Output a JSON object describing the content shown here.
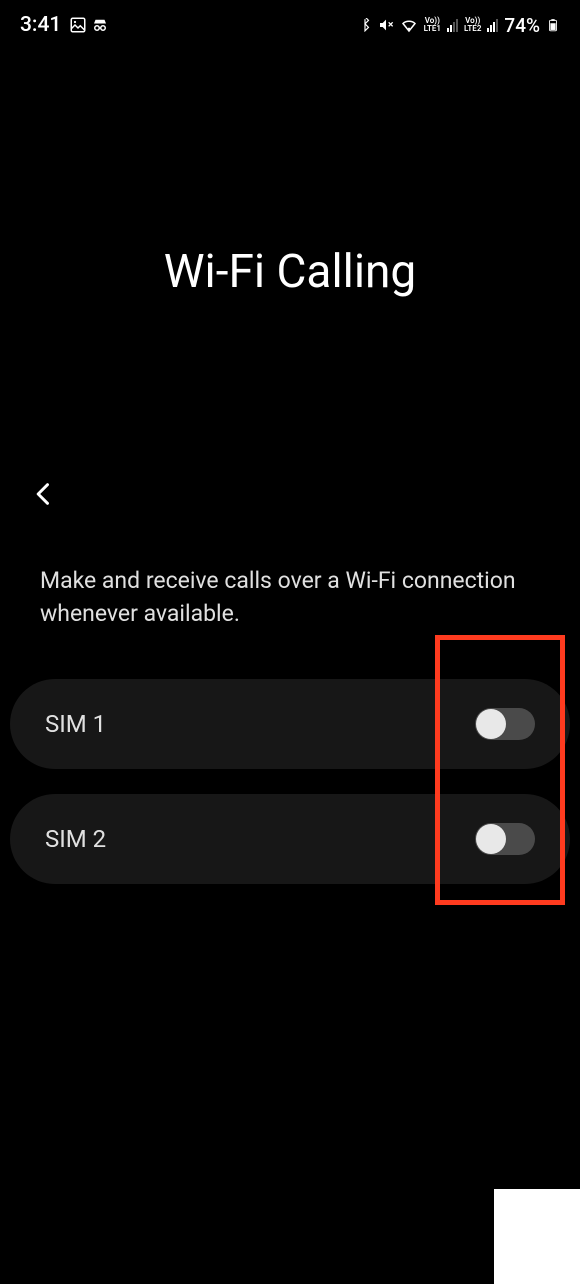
{
  "status": {
    "time": "3:41",
    "battery": "74%"
  },
  "page": {
    "title": "Wi-Fi Calling",
    "description": "Make and receive calls over a Wi-Fi connection whenever available."
  },
  "sims": [
    {
      "label": "SIM 1",
      "enabled": false
    },
    {
      "label": "SIM 2",
      "enabled": false
    }
  ]
}
